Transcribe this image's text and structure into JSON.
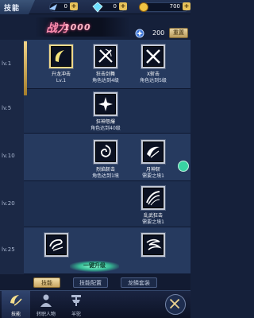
{
  "header": {
    "title": "技能",
    "resources": [
      {
        "icon": "energy-icon",
        "value": "0"
      },
      {
        "icon": "diamond-icon",
        "value": "0"
      },
      {
        "icon": "gold-coin-icon",
        "value": "700"
      }
    ]
  },
  "power": {
    "label": "战力",
    "value": "1000"
  },
  "skill_points": {
    "icon": "skill-point-icon",
    "value": "200"
  },
  "reset_label": "重置",
  "levels": [
    "lv.1",
    "lv.5",
    "lv.10",
    "lv.20",
    "lv.25"
  ],
  "skills": [
    {
      "name": "升龙冲击",
      "req": "Lv.1",
      "icon": "crescent-slash-icon",
      "active": true
    },
    {
      "name": "狂击剑舞",
      "req": "角色达到4级",
      "icon": "cross-sword-icon",
      "active": false
    },
    {
      "name": "X斩击",
      "req": "角色达到5级",
      "icon": "x-slash-icon",
      "active": false
    },
    {
      "name": "狂神怒爆",
      "req": "角色达到40级",
      "icon": "rage-burst-icon",
      "active": false
    },
    {
      "name": "烈焰斩击",
      "req": "角色达到1境",
      "icon": "flame-swirl-icon",
      "active": false
    },
    {
      "name": "月神斩",
      "req": "需要之境1",
      "icon": "moon-blade-icon",
      "active": false
    },
    {
      "name": "乱武狂击",
      "req": "需要之境1",
      "icon": "storm-slash-icon",
      "active": false
    },
    {
      "name": "",
      "req": "",
      "icon": "vortex-icon",
      "active": false
    },
    {
      "name": "",
      "req": "",
      "icon": "whirlwind-icon",
      "active": false
    }
  ],
  "scroll_label": "一键升级",
  "tabs": [
    {
      "label": "技能",
      "active": true
    },
    {
      "label": "技能配置",
      "active": false
    },
    {
      "label": "龙鳞套装",
      "active": false
    }
  ],
  "nav": [
    {
      "label": "技能",
      "icon": "skill-nav-icon",
      "active": true
    },
    {
      "label": "转职人物",
      "icon": "character-nav-icon",
      "active": false
    },
    {
      "label": "羊驼",
      "icon": "alpaca-nav-icon",
      "active": false
    }
  ],
  "colors": {
    "accent": "#f0d98a",
    "panel": "#263a5f",
    "power": "#ff8fb1"
  }
}
